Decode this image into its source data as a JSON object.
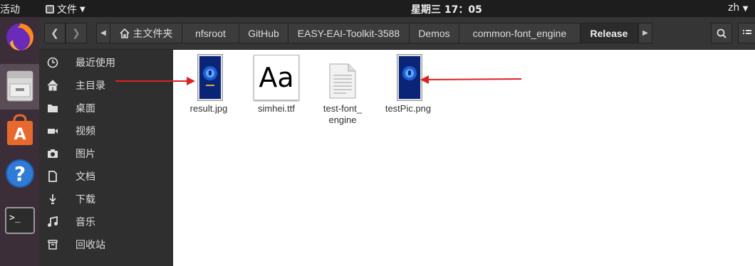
{
  "topbar": {
    "activities": "活动",
    "app_menu": "文件",
    "clock": "星期三 17：05",
    "lang": "zh"
  },
  "dock": {
    "items": [
      {
        "icon": "firefox-icon"
      },
      {
        "icon": "files-icon",
        "active": true
      },
      {
        "icon": "software-center-icon"
      },
      {
        "icon": "help-icon"
      },
      {
        "icon": "terminal-icon"
      }
    ]
  },
  "breadcrumb": {
    "home": "主文件夹",
    "items": [
      "nfsroot",
      "GitHub",
      "EASY-EAI-Toolkit-3588",
      "Demos",
      "common-font_engine",
      "Release"
    ]
  },
  "sidebar": {
    "items": [
      {
        "label": "最近使用",
        "icon": "clock-icon"
      },
      {
        "label": "主目录",
        "icon": "home-icon"
      },
      {
        "label": "桌面",
        "icon": "folder-icon"
      },
      {
        "label": "视频",
        "icon": "video-icon"
      },
      {
        "label": "图片",
        "icon": "camera-icon"
      },
      {
        "label": "文档",
        "icon": "document-icon"
      },
      {
        "label": "下载",
        "icon": "download-icon"
      },
      {
        "label": "音乐",
        "icon": "music-icon"
      },
      {
        "label": "回收站",
        "icon": "trash-icon"
      }
    ]
  },
  "files": [
    {
      "name": "result.jpg",
      "type": "image"
    },
    {
      "name": "simhei.ttf",
      "type": "font",
      "preview": "Aa"
    },
    {
      "name_line1": "test-font_",
      "name_line2": "engine",
      "type": "executable"
    },
    {
      "name": "testPic.png",
      "type": "image"
    }
  ],
  "colors": {
    "dock_bg": "#3b2e38",
    "topbar_bg": "#1d1d1d",
    "headerbar_bg": "#353535",
    "sidebar_bg": "#2f2f2f",
    "arrow": "#e02020"
  }
}
